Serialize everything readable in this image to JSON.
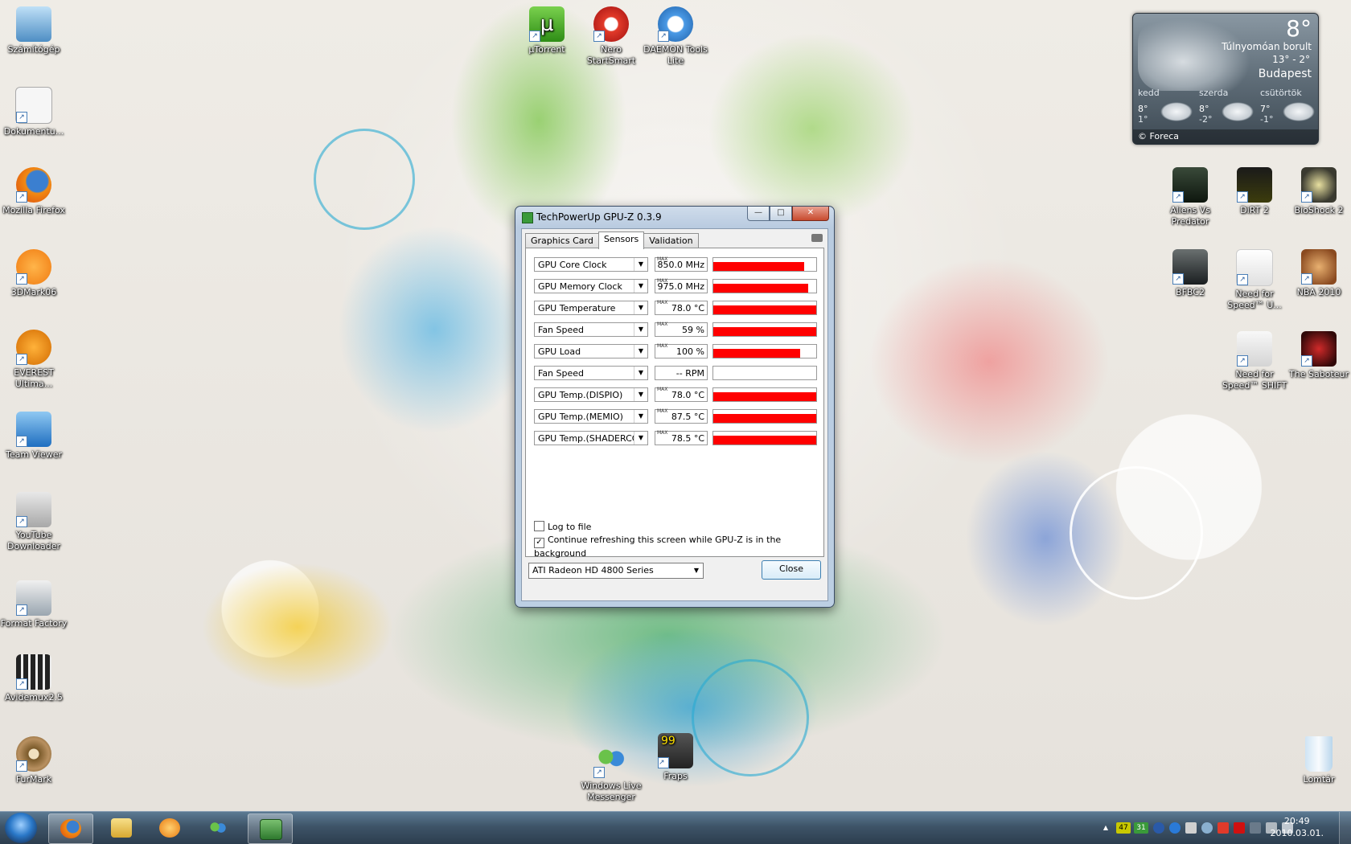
{
  "desktop": {
    "icons": [
      {
        "label": "Számítógép"
      },
      {
        "label": "Dokumentu..."
      },
      {
        "label": "Mozilla Firefox"
      },
      {
        "label": "3DMark06"
      },
      {
        "label": "EVEREST Ultima..."
      },
      {
        "label": "Team Viewer"
      },
      {
        "label": "YouTube Downloader"
      },
      {
        "label": "Format Factory"
      },
      {
        "label": "Avidemux2.5"
      },
      {
        "label": "FurMark"
      },
      {
        "label": "µTorrent"
      },
      {
        "label": "Nero StartSmart"
      },
      {
        "label": "DAEMON Tools Lite"
      },
      {
        "label": "Aliens Vs Predator"
      },
      {
        "label": "DiRT 2"
      },
      {
        "label": "BioShock 2"
      },
      {
        "label": "BFBC2"
      },
      {
        "label": "Need for Speed™ U..."
      },
      {
        "label": "NBA 2010"
      },
      {
        "label": "Need for Speed™ SHIFT"
      },
      {
        "label": "The Saboteur"
      },
      {
        "label": "Windows Live Messenger"
      },
      {
        "label": "Fraps"
      },
      {
        "label": "Lomtár"
      }
    ]
  },
  "weather": {
    "temp": "8°",
    "condition": "Túlnyomóan borult",
    "high_low": "13° - 2°",
    "city": "Budapest",
    "days": [
      {
        "name": "kedd",
        "hi": "8°",
        "lo": "1°"
      },
      {
        "name": "szerda",
        "hi": "8°",
        "lo": "-2°"
      },
      {
        "name": "csütörtök",
        "hi": "7°",
        "lo": "-1°"
      }
    ],
    "credit": "© Foreca"
  },
  "gpuz": {
    "title": "TechPowerUp GPU-Z 0.3.9",
    "tabs": [
      "Graphics Card",
      "Sensors",
      "Validation"
    ],
    "active_tab": "Sensors",
    "max_label": "MAX",
    "sensors": [
      {
        "name": "GPU Core Clock",
        "value": "850.0 MHz",
        "level": 0.88,
        "max": true
      },
      {
        "name": "GPU Memory Clock",
        "value": "975.0 MHz",
        "level": 0.92,
        "max": true
      },
      {
        "name": "GPU Temperature",
        "value": "78.0 °C",
        "level": 1.0,
        "max": true
      },
      {
        "name": "Fan Speed",
        "value": "59 %",
        "level": 1.0,
        "max": true
      },
      {
        "name": "GPU Load",
        "value": "100 %",
        "level": 0.84,
        "max": true
      },
      {
        "name": "Fan Speed",
        "value": "-- RPM",
        "level": 0,
        "max": false
      },
      {
        "name": "GPU Temp.(DISPIO)",
        "value": "78.0 °C",
        "level": 1.0,
        "max": true
      },
      {
        "name": "GPU Temp.(MEMIO)",
        "value": "87.5 °C",
        "level": 1.0,
        "max": true
      },
      {
        "name": "GPU Temp.(SHADERCORE)",
        "value": "78.5 °C",
        "level": 1.0,
        "max": true
      }
    ],
    "log_to_file_label": "Log to file",
    "log_to_file_checked": false,
    "continue_refresh_label": "Continue refreshing this screen while GPU-Z is in the background",
    "continue_refresh_checked": true,
    "gpu_select": "ATI Radeon HD 4800 Series",
    "close_label": "Close",
    "minimize_glyph": "—",
    "maximize_glyph": "□",
    "close_glyph": "✕"
  },
  "taskbar": {
    "tray_badges": [
      "47",
      "31"
    ],
    "time": "20:49",
    "date": "2010.03.01.",
    "tray_up_glyph": "▲"
  }
}
